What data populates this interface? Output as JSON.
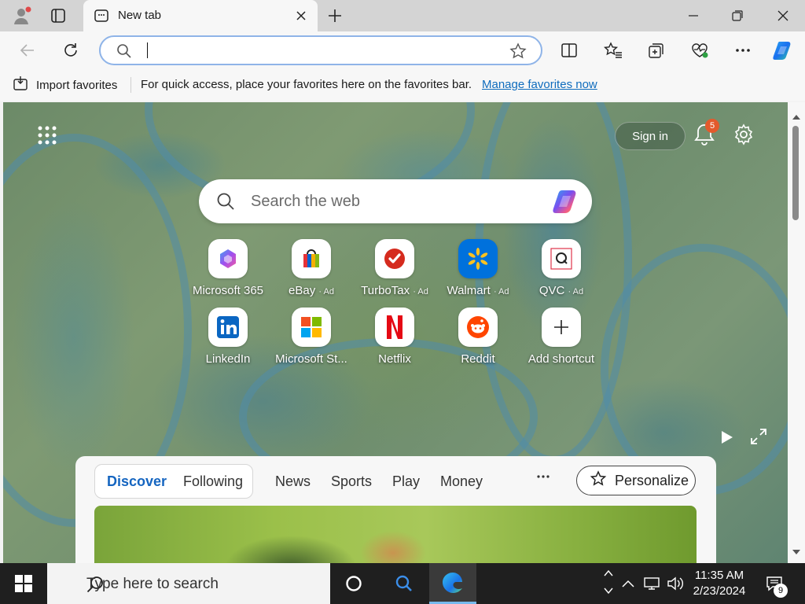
{
  "browser": {
    "tab_title": "New tab",
    "address_value": "",
    "address_placeholder": ""
  },
  "favorites_bar": {
    "import_label": "Import favorites",
    "message": "For quick access, place your favorites here on the favorites bar.",
    "manage_link": "Manage favorites now"
  },
  "page": {
    "sign_in": "Sign in",
    "notification_count": "5",
    "search_placeholder": "Search the web",
    "shortcuts": [
      {
        "label": "Microsoft 365",
        "ad": ""
      },
      {
        "label": "eBay",
        "ad": "· Ad"
      },
      {
        "label": "TurboTax",
        "ad": "· Ad"
      },
      {
        "label": "Walmart",
        "ad": "· Ad"
      },
      {
        "label": "QVC",
        "ad": "· Ad"
      },
      {
        "label": "LinkedIn",
        "ad": ""
      },
      {
        "label": "Microsoft St...",
        "ad": ""
      },
      {
        "label": "Netflix",
        "ad": ""
      },
      {
        "label": "Reddit",
        "ad": ""
      },
      {
        "label": "Add shortcut",
        "ad": ""
      }
    ],
    "feed": {
      "tabs": [
        "Discover",
        "Following",
        "News",
        "Sports",
        "Play",
        "Money"
      ],
      "personalize": "Personalize"
    }
  },
  "taskbar": {
    "search_placeholder": "Type here to search",
    "time": "11:35 AM",
    "date": "2/23/2024",
    "notification_count": "9"
  },
  "colors": {
    "accent": "#0f6cbd",
    "taskbar": "#1f1f1f",
    "badge": "#e35a2c"
  }
}
